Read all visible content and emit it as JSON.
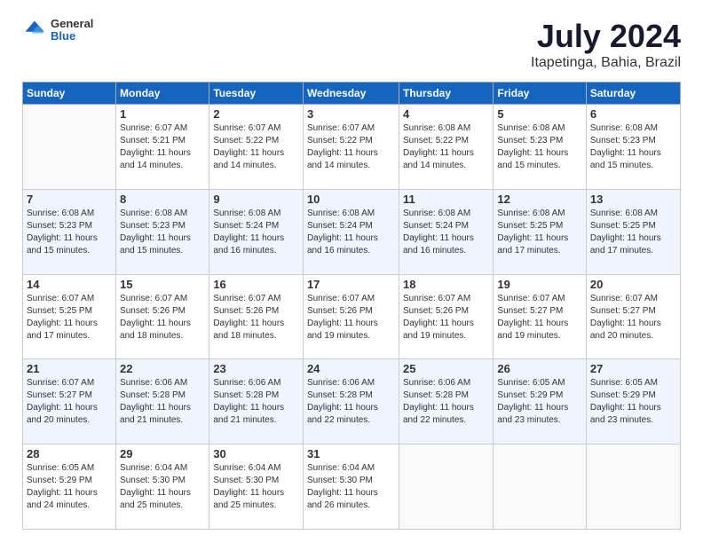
{
  "header": {
    "logo": {
      "general": "General",
      "blue": "Blue"
    },
    "title": "July 2024",
    "subtitle": "Itapetinga, Bahia, Brazil"
  },
  "calendar": {
    "weekdays": [
      "Sunday",
      "Monday",
      "Tuesday",
      "Wednesday",
      "Thursday",
      "Friday",
      "Saturday"
    ],
    "weeks": [
      [
        {
          "day": "",
          "sunrise": "",
          "sunset": "",
          "daylight": ""
        },
        {
          "day": "1",
          "sunrise": "Sunrise: 6:07 AM",
          "sunset": "Sunset: 5:21 PM",
          "daylight": "Daylight: 11 hours and 14 minutes."
        },
        {
          "day": "2",
          "sunrise": "Sunrise: 6:07 AM",
          "sunset": "Sunset: 5:22 PM",
          "daylight": "Daylight: 11 hours and 14 minutes."
        },
        {
          "day": "3",
          "sunrise": "Sunrise: 6:07 AM",
          "sunset": "Sunset: 5:22 PM",
          "daylight": "Daylight: 11 hours and 14 minutes."
        },
        {
          "day": "4",
          "sunrise": "Sunrise: 6:08 AM",
          "sunset": "Sunset: 5:22 PM",
          "daylight": "Daylight: 11 hours and 14 minutes."
        },
        {
          "day": "5",
          "sunrise": "Sunrise: 6:08 AM",
          "sunset": "Sunset: 5:23 PM",
          "daylight": "Daylight: 11 hours and 15 minutes."
        },
        {
          "day": "6",
          "sunrise": "Sunrise: 6:08 AM",
          "sunset": "Sunset: 5:23 PM",
          "daylight": "Daylight: 11 hours and 15 minutes."
        }
      ],
      [
        {
          "day": "7",
          "sunrise": "Sunrise: 6:08 AM",
          "sunset": "Sunset: 5:23 PM",
          "daylight": "Daylight: 11 hours and 15 minutes."
        },
        {
          "day": "8",
          "sunrise": "Sunrise: 6:08 AM",
          "sunset": "Sunset: 5:23 PM",
          "daylight": "Daylight: 11 hours and 15 minutes."
        },
        {
          "day": "9",
          "sunrise": "Sunrise: 6:08 AM",
          "sunset": "Sunset: 5:24 PM",
          "daylight": "Daylight: 11 hours and 16 minutes."
        },
        {
          "day": "10",
          "sunrise": "Sunrise: 6:08 AM",
          "sunset": "Sunset: 5:24 PM",
          "daylight": "Daylight: 11 hours and 16 minutes."
        },
        {
          "day": "11",
          "sunrise": "Sunrise: 6:08 AM",
          "sunset": "Sunset: 5:24 PM",
          "daylight": "Daylight: 11 hours and 16 minutes."
        },
        {
          "day": "12",
          "sunrise": "Sunrise: 6:08 AM",
          "sunset": "Sunset: 5:25 PM",
          "daylight": "Daylight: 11 hours and 17 minutes."
        },
        {
          "day": "13",
          "sunrise": "Sunrise: 6:08 AM",
          "sunset": "Sunset: 5:25 PM",
          "daylight": "Daylight: 11 hours and 17 minutes."
        }
      ],
      [
        {
          "day": "14",
          "sunrise": "Sunrise: 6:07 AM",
          "sunset": "Sunset: 5:25 PM",
          "daylight": "Daylight: 11 hours and 17 minutes."
        },
        {
          "day": "15",
          "sunrise": "Sunrise: 6:07 AM",
          "sunset": "Sunset: 5:26 PM",
          "daylight": "Daylight: 11 hours and 18 minutes."
        },
        {
          "day": "16",
          "sunrise": "Sunrise: 6:07 AM",
          "sunset": "Sunset: 5:26 PM",
          "daylight": "Daylight: 11 hours and 18 minutes."
        },
        {
          "day": "17",
          "sunrise": "Sunrise: 6:07 AM",
          "sunset": "Sunset: 5:26 PM",
          "daylight": "Daylight: 11 hours and 19 minutes."
        },
        {
          "day": "18",
          "sunrise": "Sunrise: 6:07 AM",
          "sunset": "Sunset: 5:26 PM",
          "daylight": "Daylight: 11 hours and 19 minutes."
        },
        {
          "day": "19",
          "sunrise": "Sunrise: 6:07 AM",
          "sunset": "Sunset: 5:27 PM",
          "daylight": "Daylight: 11 hours and 19 minutes."
        },
        {
          "day": "20",
          "sunrise": "Sunrise: 6:07 AM",
          "sunset": "Sunset: 5:27 PM",
          "daylight": "Daylight: 11 hours and 20 minutes."
        }
      ],
      [
        {
          "day": "21",
          "sunrise": "Sunrise: 6:07 AM",
          "sunset": "Sunset: 5:27 PM",
          "daylight": "Daylight: 11 hours and 20 minutes."
        },
        {
          "day": "22",
          "sunrise": "Sunrise: 6:06 AM",
          "sunset": "Sunset: 5:28 PM",
          "daylight": "Daylight: 11 hours and 21 minutes."
        },
        {
          "day": "23",
          "sunrise": "Sunrise: 6:06 AM",
          "sunset": "Sunset: 5:28 PM",
          "daylight": "Daylight: 11 hours and 21 minutes."
        },
        {
          "day": "24",
          "sunrise": "Sunrise: 6:06 AM",
          "sunset": "Sunset: 5:28 PM",
          "daylight": "Daylight: 11 hours and 22 minutes."
        },
        {
          "day": "25",
          "sunrise": "Sunrise: 6:06 AM",
          "sunset": "Sunset: 5:28 PM",
          "daylight": "Daylight: 11 hours and 22 minutes."
        },
        {
          "day": "26",
          "sunrise": "Sunrise: 6:05 AM",
          "sunset": "Sunset: 5:29 PM",
          "daylight": "Daylight: 11 hours and 23 minutes."
        },
        {
          "day": "27",
          "sunrise": "Sunrise: 6:05 AM",
          "sunset": "Sunset: 5:29 PM",
          "daylight": "Daylight: 11 hours and 23 minutes."
        }
      ],
      [
        {
          "day": "28",
          "sunrise": "Sunrise: 6:05 AM",
          "sunset": "Sunset: 5:29 PM",
          "daylight": "Daylight: 11 hours and 24 minutes."
        },
        {
          "day": "29",
          "sunrise": "Sunrise: 6:04 AM",
          "sunset": "Sunset: 5:30 PM",
          "daylight": "Daylight: 11 hours and 25 minutes."
        },
        {
          "day": "30",
          "sunrise": "Sunrise: 6:04 AM",
          "sunset": "Sunset: 5:30 PM",
          "daylight": "Daylight: 11 hours and 25 minutes."
        },
        {
          "day": "31",
          "sunrise": "Sunrise: 6:04 AM",
          "sunset": "Sunset: 5:30 PM",
          "daylight": "Daylight: 11 hours and 26 minutes."
        },
        {
          "day": "",
          "sunrise": "",
          "sunset": "",
          "daylight": ""
        },
        {
          "day": "",
          "sunrise": "",
          "sunset": "",
          "daylight": ""
        },
        {
          "day": "",
          "sunrise": "",
          "sunset": "",
          "daylight": ""
        }
      ]
    ]
  }
}
